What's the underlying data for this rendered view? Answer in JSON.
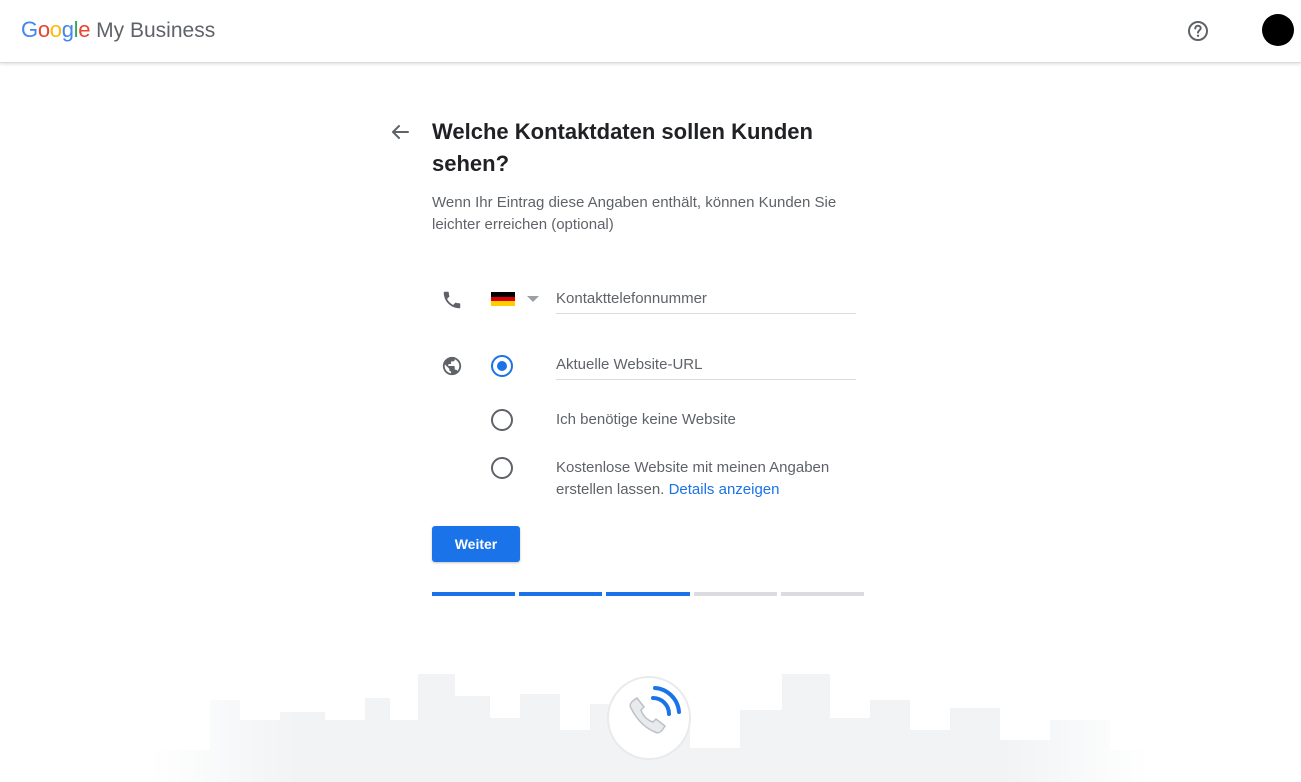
{
  "header": {
    "logo_google": "Google",
    "logo_product": "My Business",
    "help_icon": "help-circle-icon",
    "avatar": "account-avatar"
  },
  "page": {
    "title": "Welche Kontaktdaten sollen Kunden sehen?",
    "subtitle": "Wenn Ihr Eintrag diese Angaben enthält, können Kunden Sie leichter erreichen (optional)"
  },
  "phone": {
    "icon": "phone-icon",
    "country_flag": "germany-flag",
    "placeholder": "Kontakttelefonnummer",
    "value": ""
  },
  "website": {
    "icon": "globe-icon",
    "url_placeholder": "Aktuelle Website-URL",
    "url_value": "",
    "options": [
      {
        "label": "",
        "selected": true
      },
      {
        "label": "Ich benötige keine Website",
        "selected": false
      },
      {
        "label": "Kostenlose Website mit meinen Angaben erstellen lassen.",
        "link": "Details anzeigen",
        "selected": false
      }
    ]
  },
  "actions": {
    "next_label": "Weiter"
  },
  "progress": {
    "total_steps": 5,
    "completed_steps": 3
  },
  "colors": {
    "accent": "#1a73e8",
    "text_secondary": "#5f6368",
    "divider": "#dadce0"
  }
}
